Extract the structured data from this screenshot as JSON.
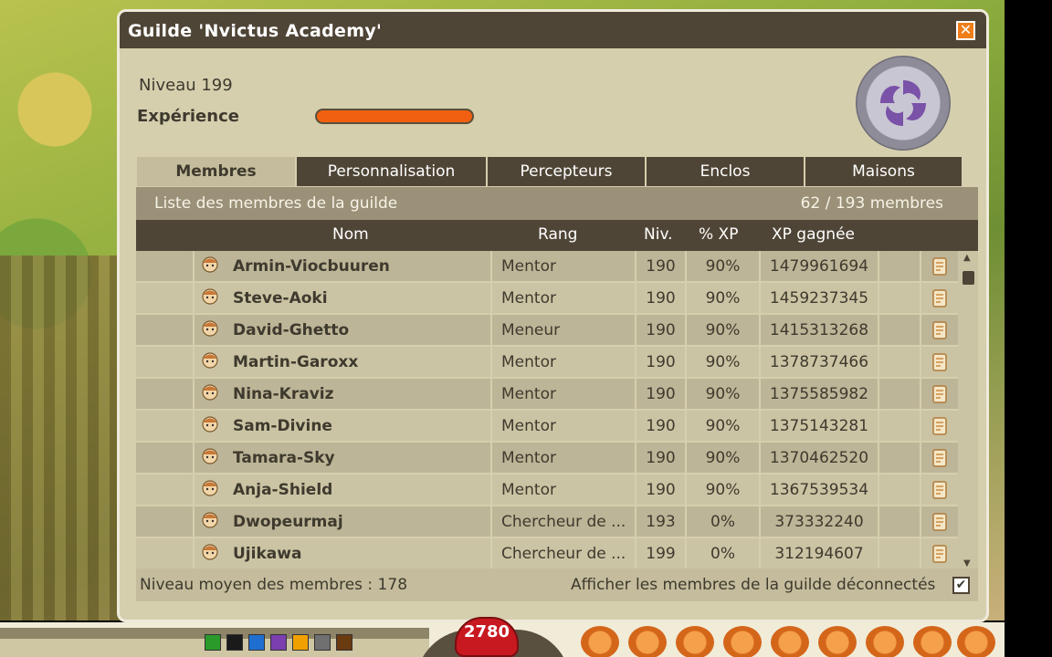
{
  "window": {
    "title": "Guilde 'Nvictus Academy'",
    "close_label": "✕"
  },
  "guild": {
    "level_label": "Niveau 199",
    "experience_label": "Expérience",
    "experience_progress": 1.0,
    "emblem_icon": "spiral-emblem-icon"
  },
  "tabs": [
    {
      "label": "Membres",
      "active": true
    },
    {
      "label": "Personnalisation",
      "active": false
    },
    {
      "label": "Percepteurs",
      "active": false
    },
    {
      "label": "Enclos",
      "active": false
    },
    {
      "label": "Maisons",
      "active": false
    }
  ],
  "members_list": {
    "header_left": "Liste des membres de la guilde",
    "header_right": "62 / 193 membres",
    "columns": {
      "name": "Nom",
      "rank": "Rang",
      "level": "Niv.",
      "xp_percent": "% XP",
      "xp_earned": "XP gagnée"
    },
    "rows": [
      {
        "name": "Armin-Viocbuuren",
        "rank": "Mentor",
        "level": "190",
        "xp_percent": "90%",
        "xp_earned": "1479961694",
        "avatar": "white-beard-avatar-icon"
      },
      {
        "name": "Steve-Aoki",
        "rank": "Mentor",
        "level": "190",
        "xp_percent": "90%",
        "xp_earned": "1459237345",
        "avatar": "green-hat-avatar-icon"
      },
      {
        "name": "David-Ghetto",
        "rank": "Meneur",
        "level": "190",
        "xp_percent": "90%",
        "xp_earned": "1415313268",
        "avatar": "panda-avatar-icon"
      },
      {
        "name": "Martin-Garoxx",
        "rank": "Mentor",
        "level": "190",
        "xp_percent": "90%",
        "xp_earned": "1378737466",
        "avatar": "orange-avatar-icon"
      },
      {
        "name": "Nina-Kraviz",
        "rank": "Mentor",
        "level": "190",
        "xp_percent": "90%",
        "xp_earned": "1375585982",
        "avatar": "orange-hair-avatar-icon"
      },
      {
        "name": "Sam-Divine",
        "rank": "Mentor",
        "level": "190",
        "xp_percent": "90%",
        "xp_earned": "1375143281",
        "avatar": "spiky-hair-avatar-icon"
      },
      {
        "name": "Tamara-Sky",
        "rank": "Mentor",
        "level": "190",
        "xp_percent": "90%",
        "xp_earned": "1370462520",
        "avatar": "cow-avatar-icon"
      },
      {
        "name": "Anja-Shield",
        "rank": "Mentor",
        "level": "190",
        "xp_percent": "90%",
        "xp_earned": "1367539534",
        "avatar": "brown-hair-avatar-icon"
      },
      {
        "name": "Dwopeurmaj",
        "rank": "Chercheur de ...",
        "level": "193",
        "xp_percent": "0%",
        "xp_earned": "373332240",
        "avatar": "white-beard-avatar-icon"
      },
      {
        "name": "Ujikawa",
        "rank": "Chercheur de ...",
        "level": "199",
        "xp_percent": "0%",
        "xp_earned": "312194607",
        "avatar": "spiky-hair-avatar-icon"
      }
    ],
    "row_action_icon": "scroll-parchment-icon"
  },
  "footer": {
    "average_level": "Niveau moyen des membres : 178",
    "show_disconnected_label": "Afficher les membres de la guilde déconnectés",
    "show_disconnected_checked": "✔"
  },
  "hud": {
    "life_value": "2780",
    "color_swatches": [
      "#2a9a2a",
      "#1a1a1a",
      "#1f6fd0",
      "#7b3fb0",
      "#f0a000",
      "#707070",
      "#6a3a10"
    ]
  },
  "colors": {
    "title_bar": "#4f4536",
    "window_bg": "#d5cfae",
    "accent_orange": "#f06010"
  }
}
